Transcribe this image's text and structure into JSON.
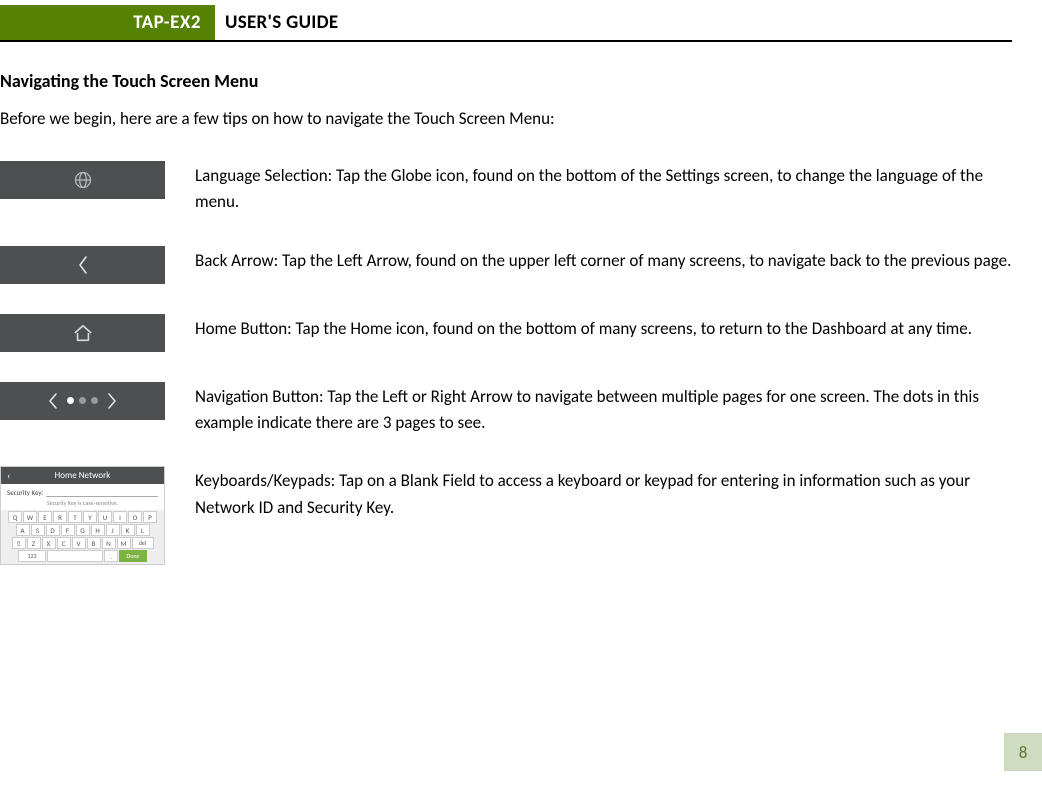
{
  "header": {
    "product": "TAP-EX2",
    "title": "USER'S GUIDE"
  },
  "section_title": "Navigating the Touch Screen Menu",
  "intro": "Before we begin, here are a few tips on how to navigate the Touch Screen Menu:",
  "items": [
    {
      "desc": "Language Selection:  Tap the Globe icon, found on the bottom of the Settings screen, to change the language of the menu."
    },
    {
      "desc": "Back Arrow:  Tap the Left Arrow, found on the upper left corner of many screens, to navigate back to the previous page."
    },
    {
      "desc": "Home Button: Tap the Home icon, found on the bottom of many screens, to return to the Dashboard at any time."
    },
    {
      "desc": "Navigation Button: Tap the Left or Right Arrow to navigate between multiple pages for one screen. The dots in this example indicate there are 3 pages to see."
    },
    {
      "desc": "Keyboards/Keypads: Tap on a Blank Field to access a keyboard or keypad for entering in information such as your Network ID and Security Key."
    }
  ],
  "keyboard_thumb": {
    "title": "Home Network",
    "field_label": "Security Key:",
    "note": "Security Key is case-sensitive.",
    "rows": [
      [
        "Q",
        "W",
        "E",
        "R",
        "T",
        "Y",
        "U",
        "I",
        "O",
        "P"
      ],
      [
        "A",
        "S",
        "D",
        "F",
        "G",
        "H",
        "J",
        "K",
        "L"
      ],
      [
        "⇧",
        "Z",
        "X",
        "C",
        "V",
        "B",
        "N",
        "M",
        "del"
      ]
    ],
    "bottom": {
      "num": "123",
      "done": "Done"
    }
  },
  "page_number": "8"
}
